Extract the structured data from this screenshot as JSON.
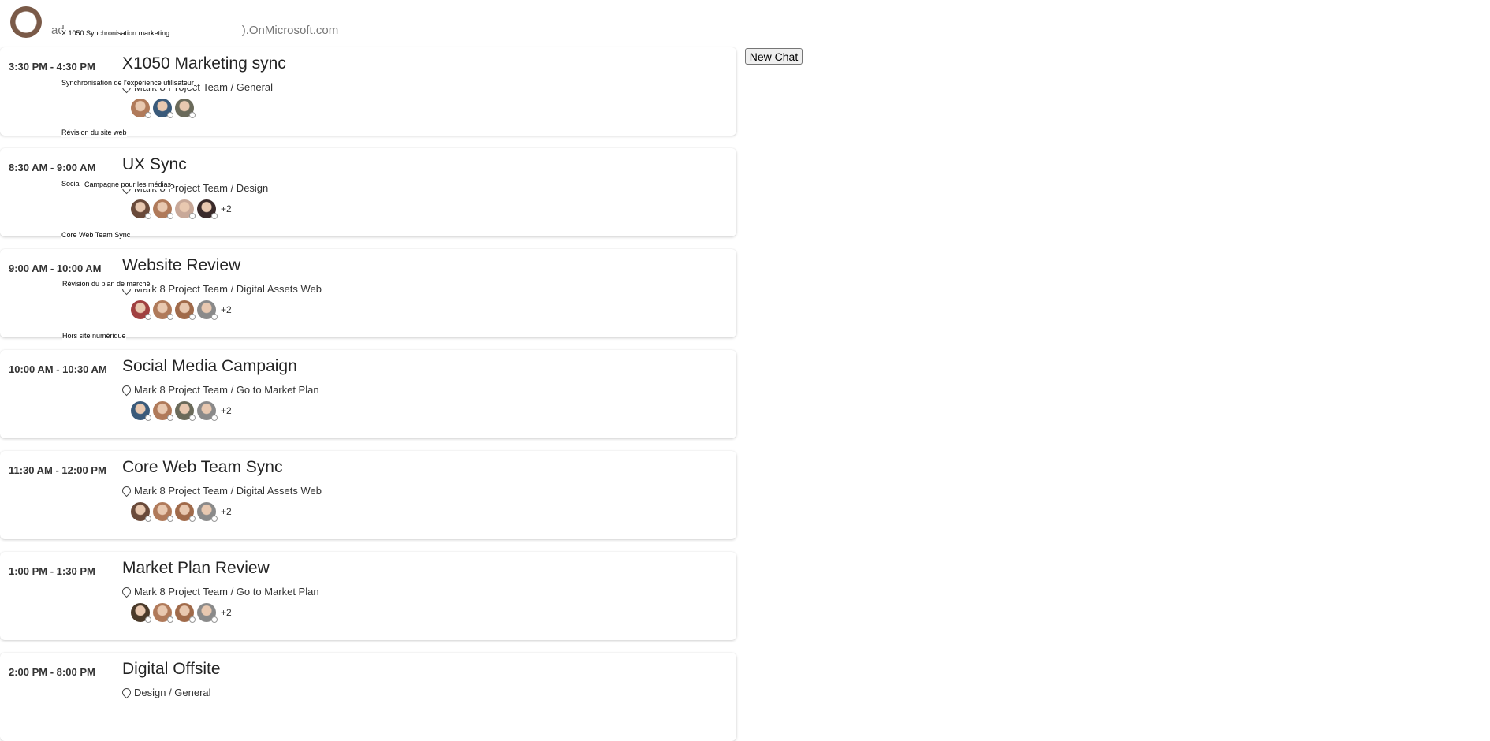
{
  "header": {
    "email_prefix": "ad",
    "email_suffix": ").OnMicrosoft.com"
  },
  "new_chat_label": "New Chat",
  "meetings": [
    {
      "time": "3:30 PM - 4:30 PM",
      "title": "X1050 Marketing sync",
      "location": "Mark 8 Project Team / General",
      "avatars": [
        "#b07a5a",
        "#3a5a7a",
        "#6a6a5a"
      ],
      "more": ""
    },
    {
      "time": "8:30 AM - 9:00 AM",
      "title": "UX Sync",
      "location": "Mark 8 Project Team / Design",
      "avatars": [
        "#6a4a3a",
        "#b07a5a",
        "#c8a898",
        "#3a2a2a"
      ],
      "more": "+2"
    },
    {
      "time": "9:00 AM - 10:00 AM",
      "title": "Website Review",
      "location": "Mark 8 Project Team / Digital Assets Web",
      "avatars": [
        "#a04040",
        "#b07a5a",
        "#a06a4a",
        "#8a8a8a"
      ],
      "more": "+2"
    },
    {
      "time": "10:00 AM - 10:30 AM",
      "title": "Social Media Campaign",
      "location": "Mark 8 Project Team / Go to Market Plan",
      "avatars": [
        "#3a5a7a",
        "#b07a5a",
        "#6a6a5a",
        "#8a8a8a"
      ],
      "more": "+2"
    },
    {
      "time": "11:30 AM - 12:00 PM",
      "title": "Core Web Team Sync",
      "location": "Mark 8 Project Team / Digital Assets Web",
      "avatars": [
        "#6a4a3a",
        "#b07a5a",
        "#a06a4a",
        "#8a8a8a"
      ],
      "more": "+2"
    },
    {
      "time": "1:00 PM - 1:30 PM",
      "title": "Market Plan Review",
      "location": "Mark 8 Project Team / Go to Market Plan",
      "avatars": [
        "#4a3a2a",
        "#b07a5a",
        "#a06a4a",
        "#8a8a8a"
      ],
      "more": "+2"
    },
    {
      "time": "2:00 PM - 8:00 PM",
      "title": "Digital Offsite",
      "location": "Design / General",
      "avatars": [],
      "more": ""
    }
  ],
  "overlay_labels": [
    "X 1050 Synchronisation marketing",
    "Synchronisation  de  l'expérience  utilisateur",
    "Révision du site web",
    "Social",
    "Campagne pour les médias",
    "Core Web Team Sync",
    "Révision du plan de marché",
    "Hors site numérique"
  ]
}
